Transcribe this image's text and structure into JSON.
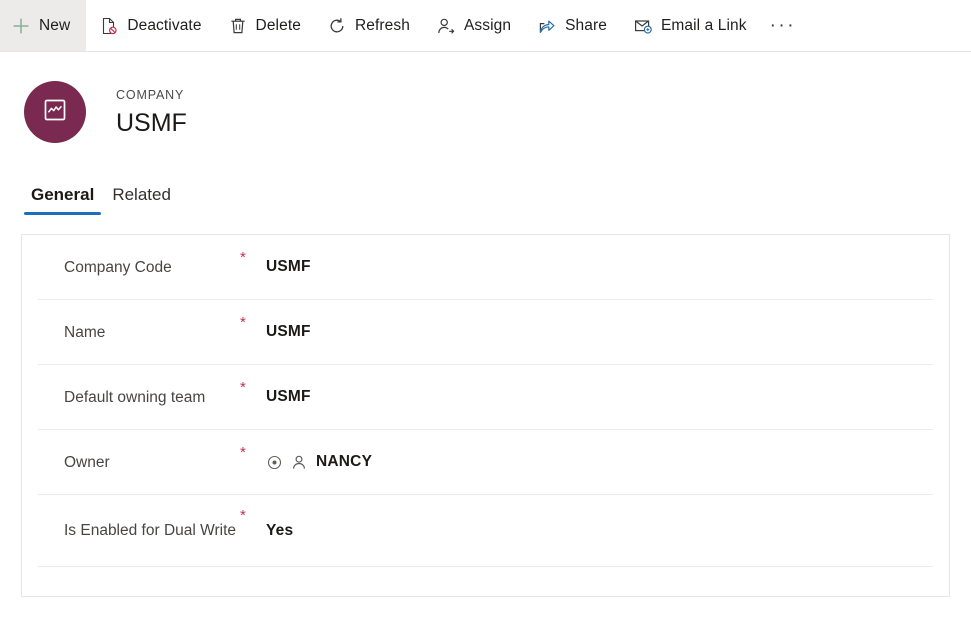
{
  "commandbar": {
    "buttons": [
      {
        "label": "New",
        "icon": "plus-icon"
      },
      {
        "label": "Deactivate",
        "icon": "deactivate-icon"
      },
      {
        "label": "Delete",
        "icon": "trash-icon"
      },
      {
        "label": "Refresh",
        "icon": "refresh-icon"
      },
      {
        "label": "Assign",
        "icon": "assign-person-icon"
      },
      {
        "label": "Share",
        "icon": "share-icon"
      },
      {
        "label": "Email a Link",
        "icon": "email-link-icon"
      }
    ],
    "overflow_label": "···"
  },
  "record": {
    "kicker": "COMPANY",
    "title": "USMF",
    "avatar_icon": "company-chart-icon",
    "avatar_color": "#7a2a50"
  },
  "tabs": [
    {
      "label": "General",
      "active": true
    },
    {
      "label": "Related",
      "active": false
    }
  ],
  "tab_accent_color": "#1f6fb8",
  "form": {
    "required_marker": "*",
    "rows": [
      {
        "label": "Company Code",
        "required": true,
        "value": "USMF"
      },
      {
        "label": "Name",
        "required": true,
        "value": "USMF"
      },
      {
        "label": "Default owning team",
        "required": true,
        "value": "USMF"
      },
      {
        "label": "Owner",
        "required": true,
        "value": "NANCY",
        "lock_icon": "record-lock-icon",
        "person_icon": "person-icon"
      },
      {
        "label": "Is Enabled for Dual Write",
        "required": true,
        "value": "Yes"
      }
    ]
  }
}
